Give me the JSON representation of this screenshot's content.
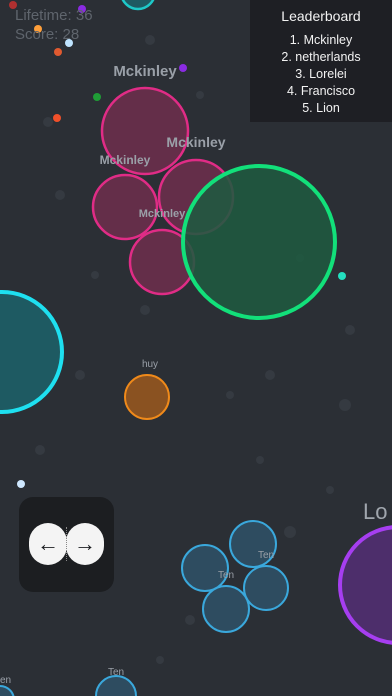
{
  "hud": {
    "lifetime_text": "Lifetime: 36",
    "score_text": "Score: 28"
  },
  "leaderboard": {
    "title": "Leaderboard",
    "entries": [
      "1. Mckinley",
      "2. netherlands",
      "3. Lorelei",
      "4. Francisco",
      "5. Lion"
    ]
  },
  "controls": {
    "split_left_icon": "arrow-left-icon",
    "split_right_icon": "arrow-right-icon",
    "left_arrow": "←",
    "right_arrow": "→"
  },
  "players": {
    "mckinley": {
      "name": "Mckinley",
      "color": "#e02c86",
      "fill": "#6e2e4c"
    },
    "mckinley_large": {
      "color": "#12e07a",
      "fill": "#1f5a40"
    },
    "huy": {
      "name": "huy",
      "color": "#f08a1a",
      "fill": "#8a5221"
    },
    "ten": {
      "name": "Ten",
      "color": "#3aa8dc",
      "fill": "#2e4c60"
    },
    "lorelei": {
      "name": "Lo",
      "color": "#a63ef0",
      "fill": "#4d2e6b"
    },
    "cyan_blob": {
      "color": "#1ee0f0",
      "fill": "#1e5a62"
    },
    "bottom_left": {
      "name": "en"
    }
  }
}
